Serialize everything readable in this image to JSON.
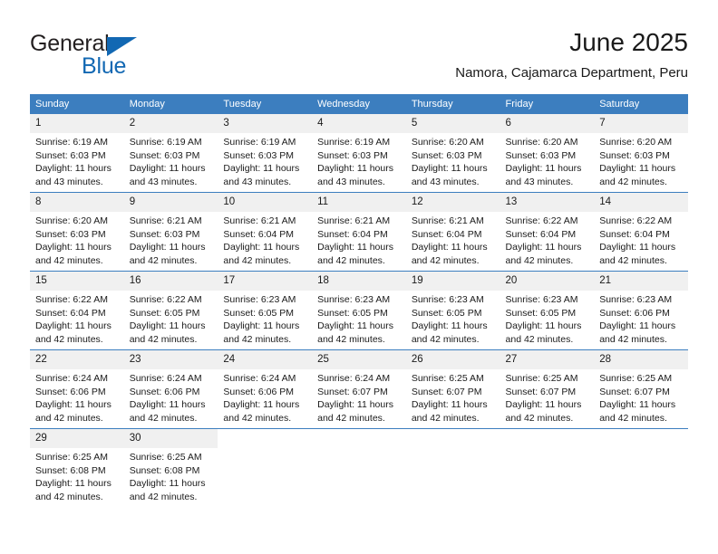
{
  "logo": {
    "text_top": "General",
    "text_bottom": "Blue",
    "triangle_color": "#1268b3",
    "top_color": "#231f20"
  },
  "header": {
    "title": "June 2025",
    "subtitle": "Namora, Cajamarca Department, Peru"
  },
  "theme": {
    "header_blue": "#3c7ebf",
    "daynum_band": "#f0f0f0",
    "text": "#1a1a1a"
  },
  "weekday_headers": [
    "Sunday",
    "Monday",
    "Tuesday",
    "Wednesday",
    "Thursday",
    "Friday",
    "Saturday"
  ],
  "weeks": [
    [
      {
        "day": "1",
        "sunrise": "Sunrise: 6:19 AM",
        "sunset": "Sunset: 6:03 PM",
        "daylight": "Daylight: 11 hours and 43 minutes."
      },
      {
        "day": "2",
        "sunrise": "Sunrise: 6:19 AM",
        "sunset": "Sunset: 6:03 PM",
        "daylight": "Daylight: 11 hours and 43 minutes."
      },
      {
        "day": "3",
        "sunrise": "Sunrise: 6:19 AM",
        "sunset": "Sunset: 6:03 PM",
        "daylight": "Daylight: 11 hours and 43 minutes."
      },
      {
        "day": "4",
        "sunrise": "Sunrise: 6:19 AM",
        "sunset": "Sunset: 6:03 PM",
        "daylight": "Daylight: 11 hours and 43 minutes."
      },
      {
        "day": "5",
        "sunrise": "Sunrise: 6:20 AM",
        "sunset": "Sunset: 6:03 PM",
        "daylight": "Daylight: 11 hours and 43 minutes."
      },
      {
        "day": "6",
        "sunrise": "Sunrise: 6:20 AM",
        "sunset": "Sunset: 6:03 PM",
        "daylight": "Daylight: 11 hours and 43 minutes."
      },
      {
        "day": "7",
        "sunrise": "Sunrise: 6:20 AM",
        "sunset": "Sunset: 6:03 PM",
        "daylight": "Daylight: 11 hours and 42 minutes."
      }
    ],
    [
      {
        "day": "8",
        "sunrise": "Sunrise: 6:20 AM",
        "sunset": "Sunset: 6:03 PM",
        "daylight": "Daylight: 11 hours and 42 minutes."
      },
      {
        "day": "9",
        "sunrise": "Sunrise: 6:21 AM",
        "sunset": "Sunset: 6:03 PM",
        "daylight": "Daylight: 11 hours and 42 minutes."
      },
      {
        "day": "10",
        "sunrise": "Sunrise: 6:21 AM",
        "sunset": "Sunset: 6:04 PM",
        "daylight": "Daylight: 11 hours and 42 minutes."
      },
      {
        "day": "11",
        "sunrise": "Sunrise: 6:21 AM",
        "sunset": "Sunset: 6:04 PM",
        "daylight": "Daylight: 11 hours and 42 minutes."
      },
      {
        "day": "12",
        "sunrise": "Sunrise: 6:21 AM",
        "sunset": "Sunset: 6:04 PM",
        "daylight": "Daylight: 11 hours and 42 minutes."
      },
      {
        "day": "13",
        "sunrise": "Sunrise: 6:22 AM",
        "sunset": "Sunset: 6:04 PM",
        "daylight": "Daylight: 11 hours and 42 minutes."
      },
      {
        "day": "14",
        "sunrise": "Sunrise: 6:22 AM",
        "sunset": "Sunset: 6:04 PM",
        "daylight": "Daylight: 11 hours and 42 minutes."
      }
    ],
    [
      {
        "day": "15",
        "sunrise": "Sunrise: 6:22 AM",
        "sunset": "Sunset: 6:04 PM",
        "daylight": "Daylight: 11 hours and 42 minutes."
      },
      {
        "day": "16",
        "sunrise": "Sunrise: 6:22 AM",
        "sunset": "Sunset: 6:05 PM",
        "daylight": "Daylight: 11 hours and 42 minutes."
      },
      {
        "day": "17",
        "sunrise": "Sunrise: 6:23 AM",
        "sunset": "Sunset: 6:05 PM",
        "daylight": "Daylight: 11 hours and 42 minutes."
      },
      {
        "day": "18",
        "sunrise": "Sunrise: 6:23 AM",
        "sunset": "Sunset: 6:05 PM",
        "daylight": "Daylight: 11 hours and 42 minutes."
      },
      {
        "day": "19",
        "sunrise": "Sunrise: 6:23 AM",
        "sunset": "Sunset: 6:05 PM",
        "daylight": "Daylight: 11 hours and 42 minutes."
      },
      {
        "day": "20",
        "sunrise": "Sunrise: 6:23 AM",
        "sunset": "Sunset: 6:05 PM",
        "daylight": "Daylight: 11 hours and 42 minutes."
      },
      {
        "day": "21",
        "sunrise": "Sunrise: 6:23 AM",
        "sunset": "Sunset: 6:06 PM",
        "daylight": "Daylight: 11 hours and 42 minutes."
      }
    ],
    [
      {
        "day": "22",
        "sunrise": "Sunrise: 6:24 AM",
        "sunset": "Sunset: 6:06 PM",
        "daylight": "Daylight: 11 hours and 42 minutes."
      },
      {
        "day": "23",
        "sunrise": "Sunrise: 6:24 AM",
        "sunset": "Sunset: 6:06 PM",
        "daylight": "Daylight: 11 hours and 42 minutes."
      },
      {
        "day": "24",
        "sunrise": "Sunrise: 6:24 AM",
        "sunset": "Sunset: 6:06 PM",
        "daylight": "Daylight: 11 hours and 42 minutes."
      },
      {
        "day": "25",
        "sunrise": "Sunrise: 6:24 AM",
        "sunset": "Sunset: 6:07 PM",
        "daylight": "Daylight: 11 hours and 42 minutes."
      },
      {
        "day": "26",
        "sunrise": "Sunrise: 6:25 AM",
        "sunset": "Sunset: 6:07 PM",
        "daylight": "Daylight: 11 hours and 42 minutes."
      },
      {
        "day": "27",
        "sunrise": "Sunrise: 6:25 AM",
        "sunset": "Sunset: 6:07 PM",
        "daylight": "Daylight: 11 hours and 42 minutes."
      },
      {
        "day": "28",
        "sunrise": "Sunrise: 6:25 AM",
        "sunset": "Sunset: 6:07 PM",
        "daylight": "Daylight: 11 hours and 42 minutes."
      }
    ],
    [
      {
        "day": "29",
        "sunrise": "Sunrise: 6:25 AM",
        "sunset": "Sunset: 6:08 PM",
        "daylight": "Daylight: 11 hours and 42 minutes."
      },
      {
        "day": "30",
        "sunrise": "Sunrise: 6:25 AM",
        "sunset": "Sunset: 6:08 PM",
        "daylight": "Daylight: 11 hours and 42 minutes."
      },
      {
        "day": "",
        "sunrise": "",
        "sunset": "",
        "daylight": ""
      },
      {
        "day": "",
        "sunrise": "",
        "sunset": "",
        "daylight": ""
      },
      {
        "day": "",
        "sunrise": "",
        "sunset": "",
        "daylight": ""
      },
      {
        "day": "",
        "sunrise": "",
        "sunset": "",
        "daylight": ""
      },
      {
        "day": "",
        "sunrise": "",
        "sunset": "",
        "daylight": ""
      }
    ]
  ]
}
